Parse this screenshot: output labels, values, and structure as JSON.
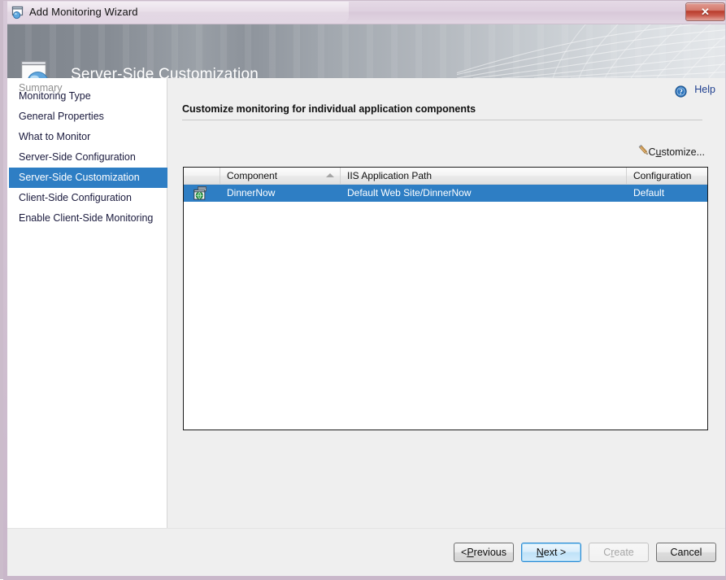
{
  "window": {
    "title": "Add Monitoring Wizard",
    "title_icon": "wizard-window-icon",
    "close_label": "✕"
  },
  "banner": {
    "heading": "Server-Side Customization",
    "icon": "window-sphere-icon"
  },
  "sidebar": {
    "items": [
      {
        "label": "Monitoring Type",
        "state": "normal"
      },
      {
        "label": "General Properties",
        "state": "normal"
      },
      {
        "label": "What to Monitor",
        "state": "normal"
      },
      {
        "label": "Server-Side Configuration",
        "state": "normal"
      },
      {
        "label": "Server-Side Customization",
        "state": "selected"
      },
      {
        "label": "Client-Side Configuration",
        "state": "normal"
      },
      {
        "label": "Enable Client-Side Monitoring",
        "state": "normal"
      },
      {
        "label": "Summary",
        "state": "disabled"
      }
    ]
  },
  "content": {
    "help_label": "Help",
    "help_icon": "help-circle-icon",
    "section_title": "Customize monitoring for individual application components",
    "customize_label_pre": "C",
    "customize_label_accel": "u",
    "customize_label_post": "stomize...",
    "customize_icon": "pencil-icon"
  },
  "grid": {
    "columns": [
      {
        "key": "icon",
        "label": ""
      },
      {
        "key": "component",
        "label": "Component",
        "sorted": "ascending"
      },
      {
        "key": "path",
        "label": "IIS Application Path"
      },
      {
        "key": "configuration",
        "label": "Configuration"
      }
    ],
    "rows": [
      {
        "icon": "web-application-icon",
        "component": "DinnerNow",
        "path": "Default Web Site/DinnerNow",
        "configuration": "Default",
        "selected": true
      }
    ]
  },
  "footer": {
    "previous": {
      "pre": "< ",
      "accel": "P",
      "post": "revious",
      "enabled": true
    },
    "next": {
      "pre": "",
      "accel": "N",
      "post": "ext >",
      "enabled": true,
      "default": true
    },
    "create": {
      "pre": "C",
      "accel": "r",
      "post": "eate",
      "enabled": false
    },
    "cancel": {
      "pre": "Cancel",
      "accel": "",
      "post": "",
      "enabled": true
    }
  },
  "colors": {
    "accent_blue": "#2e7ec4",
    "title_bar": "#ded0df",
    "banner_left": "#7e848c",
    "banner_right": "#e4e7ea",
    "panel_bg": "#efefef",
    "link_blue": "#1f3f8f"
  }
}
